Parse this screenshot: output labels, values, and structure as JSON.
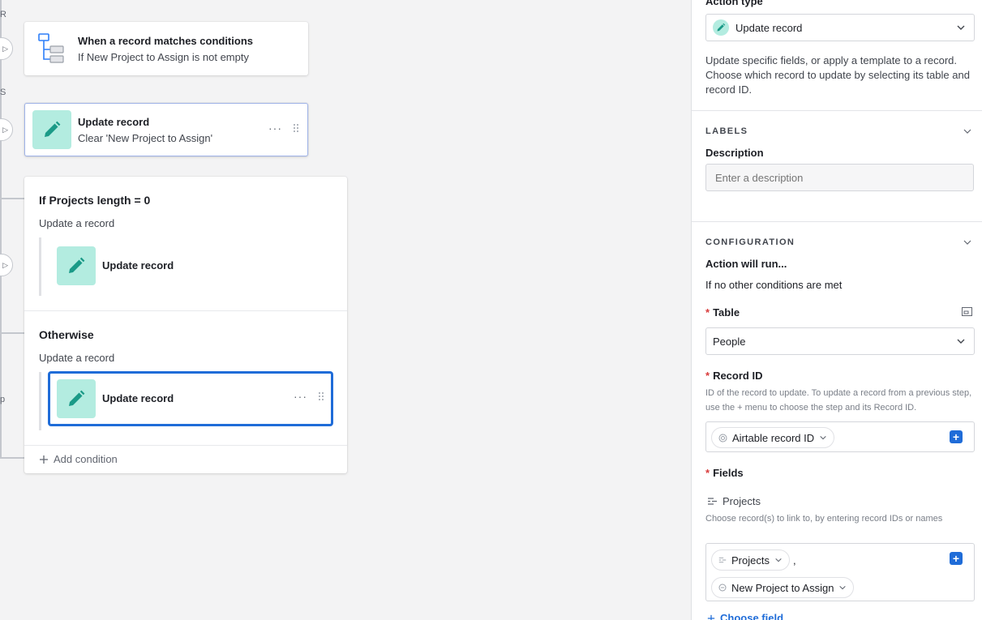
{
  "canvas": {
    "edge_labels": [
      "R",
      "S",
      "p"
    ],
    "trigger": {
      "title": "When a record matches conditions",
      "subtitle": "If New Project to Assign is not empty"
    },
    "action": {
      "title": "Update record",
      "subtitle": "Clear 'New Project to Assign'",
      "more": "···"
    },
    "condition_group": {
      "branch1": {
        "title": "If Projects length = 0",
        "subtitle": "Update a record",
        "card_title": "Update record"
      },
      "branch2": {
        "title": "Otherwise",
        "subtitle": "Update a record",
        "card_title": "Update record",
        "more": "···"
      },
      "add_condition": "Add condition"
    }
  },
  "panel": {
    "action_type_label": "Action type",
    "action_type_value": "Update record",
    "description_text": "Update specific fields, or apply a template to a record. Choose which record to update by selecting its table and record ID.",
    "labels_section": "LABELS",
    "description_label": "Description",
    "description_placeholder": "Enter a description",
    "configuration_section": "CONFIGURATION",
    "action_will_run": "Action will run...",
    "condition_text": "If no other conditions are met",
    "table_label": "Table",
    "table_value": "People",
    "record_id_label": "Record ID",
    "record_id_help": "ID of the record to update. To update a record from a previous step, use the + menu to choose the step and its Record ID.",
    "record_id_token": "Airtable record ID",
    "fields_label": "Fields",
    "field_name": "Projects",
    "field_help": "Choose record(s) to link to, by entering record IDs or names",
    "token_projects": "Projects",
    "token_separator": ",",
    "token_new_project": "New Project to Assign",
    "choose_field": "Choose field",
    "required_mark": "*"
  },
  "colors": {
    "accent": "#1f6cd8",
    "icon_bg": "#b3ece0",
    "icon_fg": "#1a9a87",
    "required": "#d83a3a"
  }
}
